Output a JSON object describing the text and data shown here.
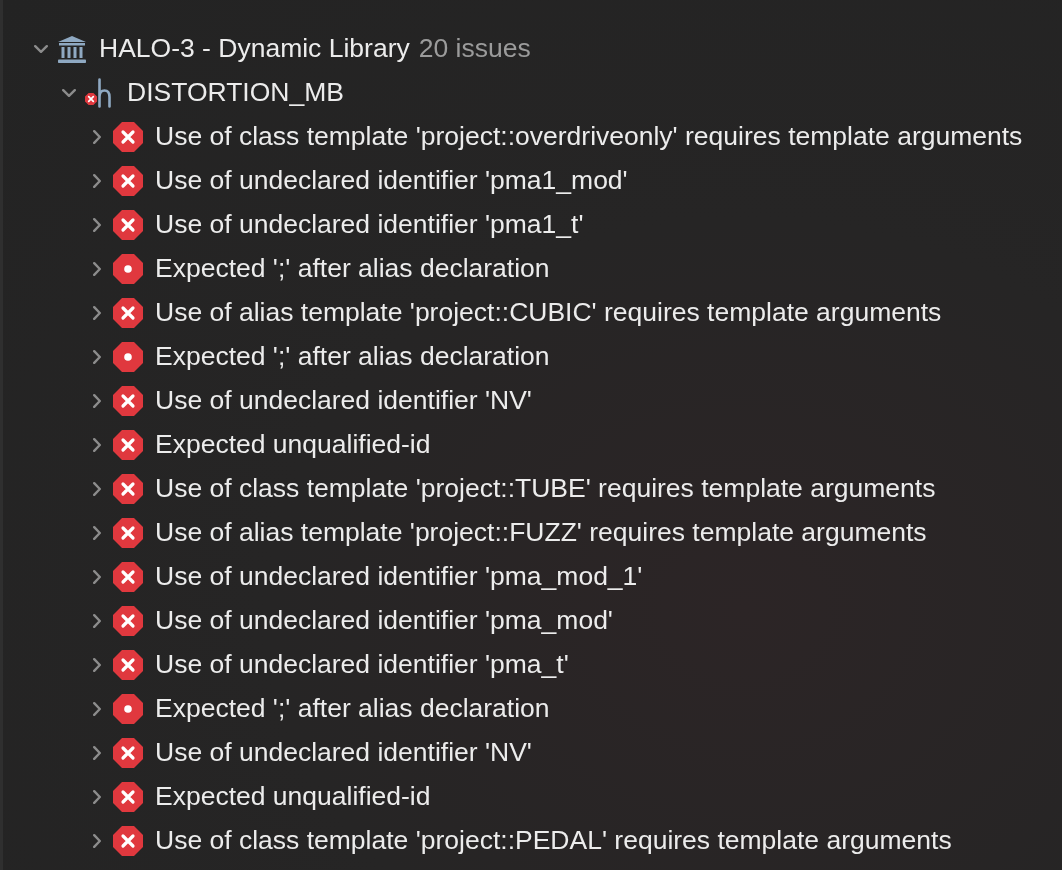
{
  "tree": [
    {
      "kind": "target",
      "label": "HALO-3 - Dynamic Library",
      "count": "20 issues",
      "expanded": true,
      "children": [
        {
          "kind": "file",
          "label": "DISTORTION_MB",
          "expanded": true,
          "children": [
            {
              "kind": "error",
              "label": "Use of class template 'project::overdriveonly' requires template arguments",
              "expanded": false
            },
            {
              "kind": "error",
              "label": "Use of undeclared identifier 'pma1_mod'",
              "expanded": false
            },
            {
              "kind": "error",
              "label": "Use of undeclared identifier 'pma1_t'",
              "expanded": false
            },
            {
              "kind": "fatal",
              "label": "Expected ';' after alias declaration",
              "expanded": false
            },
            {
              "kind": "error",
              "label": "Use of alias template 'project::CUBIC' requires template arguments",
              "expanded": false
            },
            {
              "kind": "fatal",
              "label": "Expected ';' after alias declaration",
              "expanded": false
            },
            {
              "kind": "error",
              "label": "Use of undeclared identifier 'NV'",
              "expanded": false
            },
            {
              "kind": "error",
              "label": "Expected unqualified-id",
              "expanded": false
            },
            {
              "kind": "error",
              "label": "Use of class template 'project::TUBE' requires template arguments",
              "expanded": false
            },
            {
              "kind": "error",
              "label": "Use of alias template 'project::FUZZ' requires template arguments",
              "expanded": false
            },
            {
              "kind": "error",
              "label": "Use of undeclared identifier 'pma_mod_1'",
              "expanded": false
            },
            {
              "kind": "error",
              "label": "Use of undeclared identifier 'pma_mod'",
              "expanded": false
            },
            {
              "kind": "error",
              "label": "Use of undeclared identifier 'pma_t'",
              "expanded": false
            },
            {
              "kind": "fatal",
              "label": "Expected ';' after alias declaration",
              "expanded": false
            },
            {
              "kind": "error",
              "label": "Use of undeclared identifier 'NV'",
              "expanded": false
            },
            {
              "kind": "error",
              "label": "Expected unqualified-id",
              "expanded": false
            },
            {
              "kind": "error",
              "label": "Use of class template 'project::PEDAL' requires template arguments",
              "expanded": false
            }
          ]
        }
      ]
    }
  ]
}
